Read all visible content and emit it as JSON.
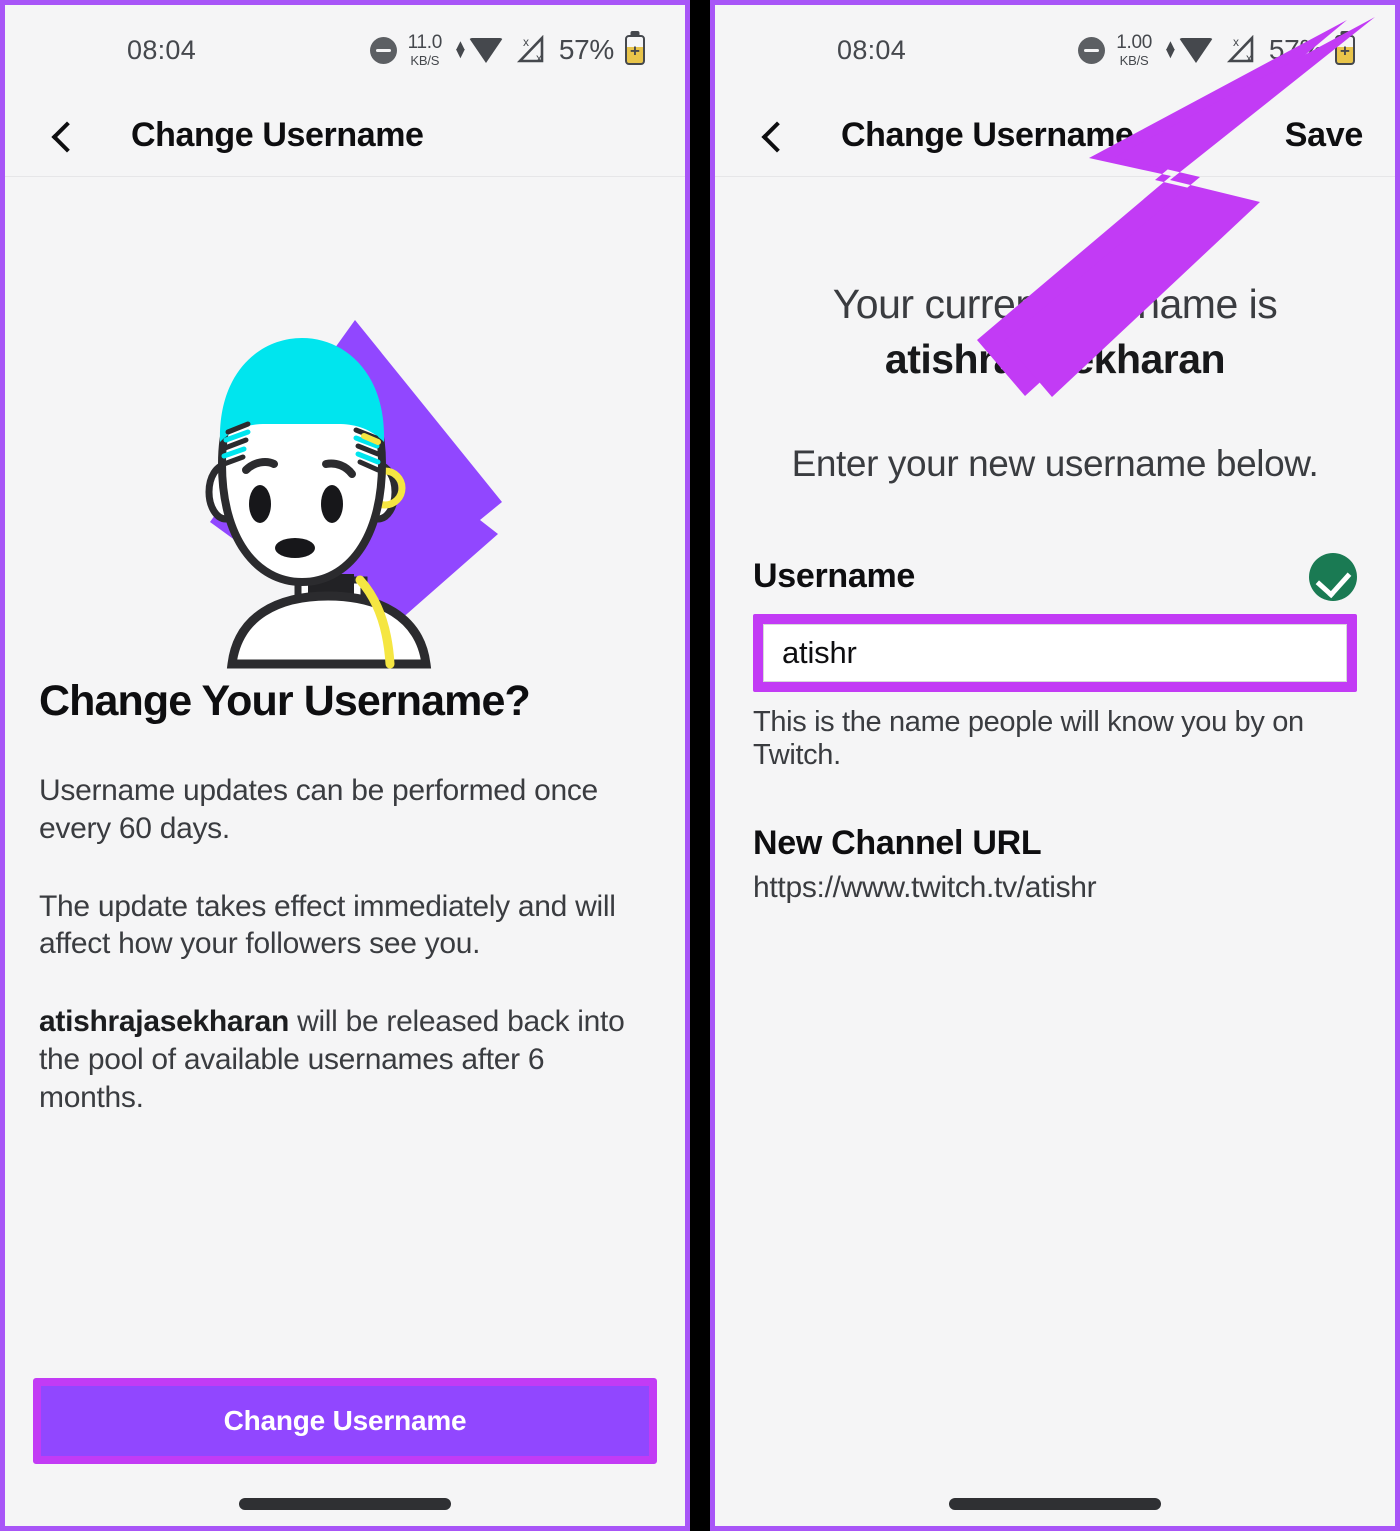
{
  "meta": {
    "accent_purple": "#9147ff",
    "annotation_purple": "#c23bf5",
    "panel_border": "#a855f7",
    "background": "#f5f5f6",
    "success_green": "#1a7a53"
  },
  "left_panel": {
    "status_bar": {
      "time": "08:04",
      "dnd_icon": "do-not-disturb-icon",
      "net_speed_value": "11.0",
      "net_speed_unit": "KB/S",
      "wifi_icon": "wifi-icon",
      "signal_icon": "signal-no-service-icon",
      "battery_percent": "57%",
      "battery_icon": "battery-saver-icon"
    },
    "header": {
      "back_icon": "back-chevron-icon",
      "title": "Change Username"
    },
    "illustration": {
      "name": "twitch-avatar-illustration",
      "diamond_color": "#9147ff",
      "hair_color": "#00e5ee",
      "accent_color": "#f5e642"
    },
    "heading": "Change Your Username?",
    "paragraphs": [
      "Username updates can be performed once every 60 days.",
      "The update takes effect immediately and will affect how your followers see you."
    ],
    "release_note": {
      "username": "atishrajasekharan",
      "rest": " will be released back into the pool of available usernames after 6 months."
    },
    "cta_button": "Change Username"
  },
  "right_panel": {
    "status_bar": {
      "time": "08:04",
      "dnd_icon": "do-not-disturb-icon",
      "net_speed_value": "1.00",
      "net_speed_unit": "KB/S",
      "wifi_icon": "wifi-icon",
      "signal_icon": "signal-no-service-icon",
      "battery_percent": "57%",
      "battery_icon": "battery-saver-icon"
    },
    "header": {
      "back_icon": "back-chevron-icon",
      "title": "Change Username",
      "save_label": "Save"
    },
    "current_username_prefix": "Your current username is",
    "current_username": "atishrajasekharan",
    "instruction": "Enter your new username below.",
    "username_field": {
      "label": "Username",
      "value": "atishr",
      "placeholder": "Username",
      "valid_icon": "check-circle-icon",
      "help_text": "This is the name people will know you by on Twitch."
    },
    "channel_url": {
      "label": "New Channel URL",
      "value": "https://www.twitch.tv/atishr"
    },
    "annotation": {
      "arrow_icon": "annotation-arrow-icon",
      "points_to": "Save"
    }
  }
}
